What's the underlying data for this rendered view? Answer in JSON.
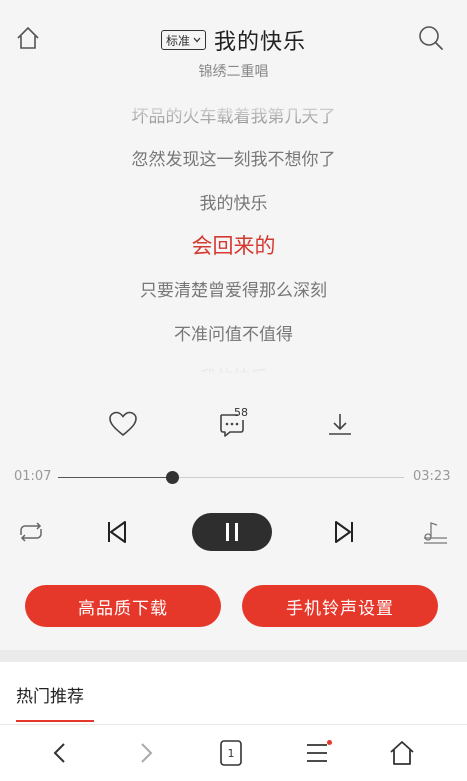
{
  "header": {
    "quality_badge": "标准",
    "song_title": "我的快乐",
    "artist": "锦绣二重唱"
  },
  "lyrics": {
    "lines": [
      "坏品的火车载着我第几天了",
      "忽然发现这一刻我不想你了",
      "我的快乐",
      "会回来的",
      "只要清楚曾爱得那么深刻",
      "不准问值不值得",
      "我的快乐"
    ],
    "current_index": 3
  },
  "actions": {
    "comment_count": "58"
  },
  "playback": {
    "elapsed": "01:07",
    "total": "03:23",
    "progress": 0.33
  },
  "buttons": {
    "hq_download": "高品质下载",
    "ringtone_setting": "手机铃声设置"
  },
  "section": {
    "hot_title": "热门推荐"
  },
  "nav": {
    "tab_count": "1"
  },
  "colors": {
    "accent": "#e6372b",
    "current_lyric": "#d33a31"
  },
  "icons": [
    "home-icon",
    "search-icon",
    "heart-icon",
    "comment-icon",
    "download-icon",
    "repeat-icon",
    "previous-icon",
    "pause-icon",
    "next-icon",
    "playlist-icon",
    "back-icon",
    "forward-icon",
    "tabs-icon",
    "menu-icon",
    "home-nav-icon"
  ]
}
